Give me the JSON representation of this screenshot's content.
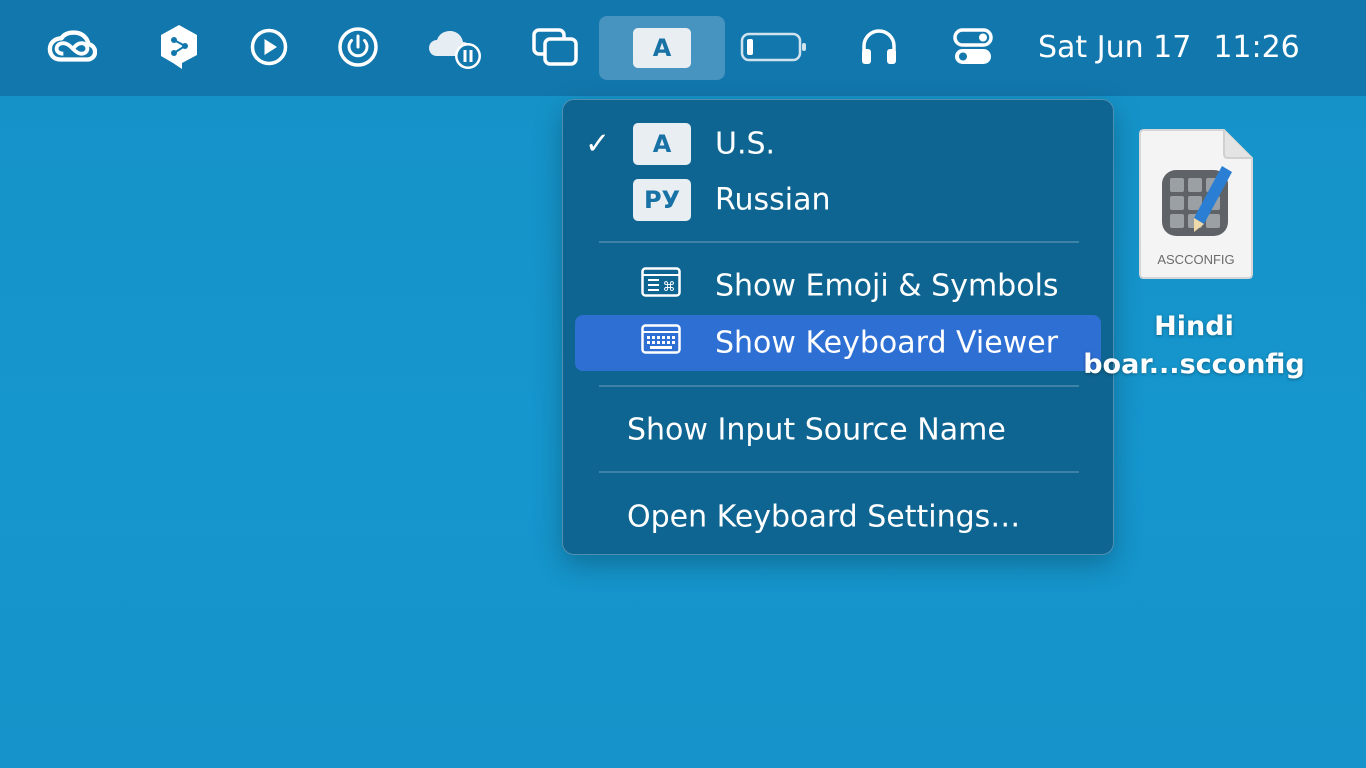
{
  "menubar": {
    "icons": [
      {
        "name": "creative-cloud-icon"
      },
      {
        "name": "deepl-icon"
      },
      {
        "name": "play-circle-icon"
      },
      {
        "name": "power-icon"
      },
      {
        "name": "cloud-sync-paused-icon"
      },
      {
        "name": "window-switcher-icon"
      },
      {
        "name": "battery-icon"
      },
      {
        "name": "headphones-icon"
      },
      {
        "name": "control-center-icon"
      }
    ],
    "input_source_badge": "A",
    "date": "Sat Jun 17",
    "time": "11:26"
  },
  "menu": {
    "items": [
      {
        "label": "U.S.",
        "badge": "A",
        "checked": true
      },
      {
        "label": "Russian",
        "badge": "РУ",
        "checked": false
      },
      {
        "label": "Show Emoji & Symbols",
        "icon": "emoji-symbols-icon"
      },
      {
        "label": "Show Keyboard Viewer",
        "icon": "keyboard-viewer-icon",
        "selected": true
      },
      {
        "label": "Show Input Source Name"
      },
      {
        "label": "Open Keyboard Settings…"
      }
    ],
    "checkmark": "✓",
    "highlight_color": "#2e6fd3"
  },
  "desktop_file": {
    "type_label": "ASCCONFIG",
    "name_line1": "Hindi",
    "name_line2": "boar...scconfig"
  }
}
